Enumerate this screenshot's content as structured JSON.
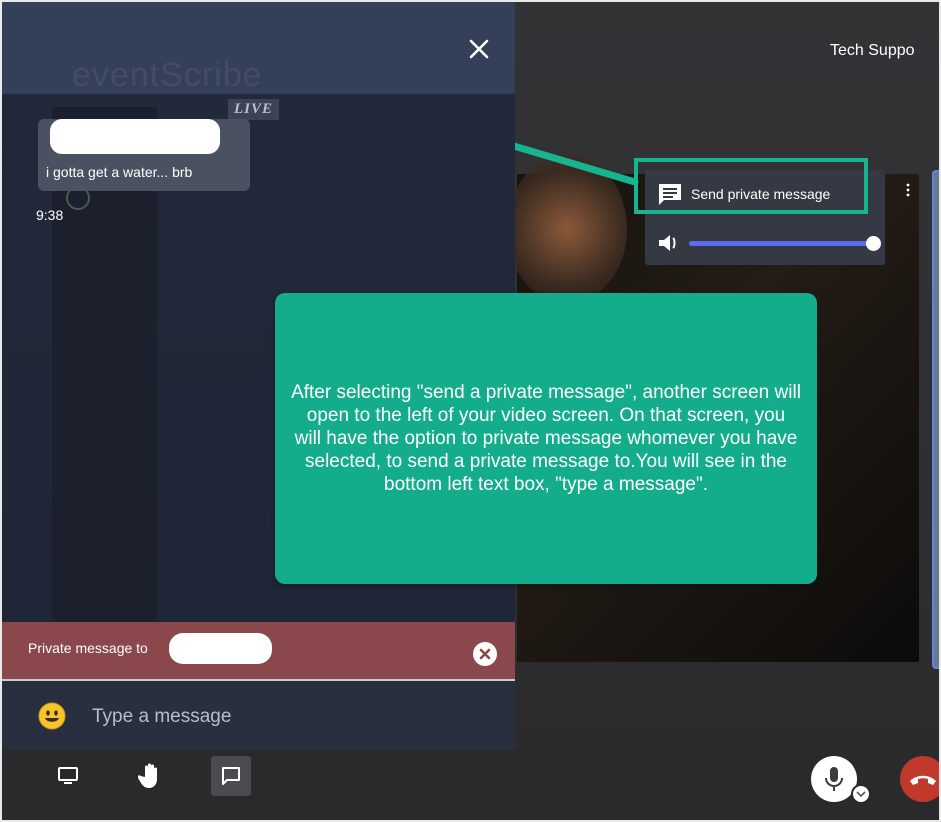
{
  "window": {
    "speaker_name": "Tech Suppo"
  },
  "chat": {
    "brand_watermark": "eventScribe",
    "live_badge": "LIVE",
    "messages": [
      {
        "text": "i gotta get a water... brb",
        "time": "9:38"
      }
    ],
    "private_label": "Private message to",
    "input_placeholder": "Type a message"
  },
  "video_menu": {
    "send_private_label": "Send private message",
    "volume_level": 1.0
  },
  "callout": {
    "text": "After selecting \"send a private message\", another screen will open to the left of your video screen. On that screen, you will have the option to private message whomever you have selected, to send a private message to.You will see in the bottom left text box, \"type a message\"."
  },
  "colors": {
    "accent_teal": "#13ad8c",
    "private_bar": "#8a484c",
    "chat_panel": "#283040",
    "volume_track": "#5b6cf0",
    "hangup": "#c0392b"
  },
  "icons": {
    "close": "close-icon",
    "message": "message-icon",
    "volume": "volume-icon",
    "emoji": "emoji-icon",
    "screen": "screen-share-icon",
    "hand": "raise-hand-icon",
    "chat": "chat-icon",
    "mic": "microphone-icon",
    "hangup": "hangup-icon"
  }
}
